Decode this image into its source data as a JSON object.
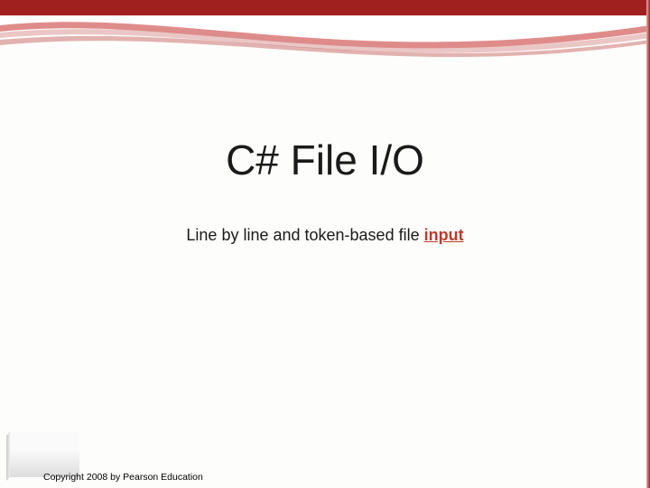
{
  "title": "C# File I/O",
  "subtitle": {
    "prefix": "Line by line and token-based file ",
    "emphasis": "input"
  },
  "copyright": "Copyright 2008 by Pearson Education"
}
